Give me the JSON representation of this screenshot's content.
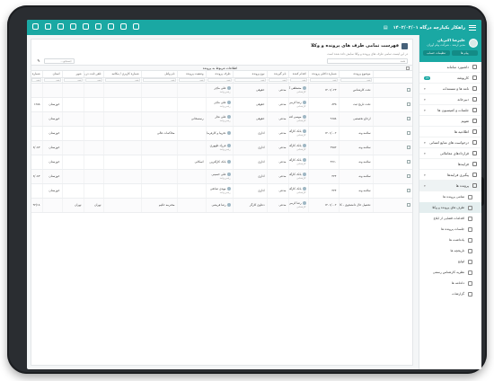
{
  "app": {
    "title": "راهکار یکپارچه درگاه ۱۴۰۲/۰۲/۰۱"
  },
  "profile": {
    "name": "علیرضا اکبریان",
    "role": "مدیر ارشد - شرکت پیام آوران",
    "btn_inbox": "پیام ها",
    "btn_settings": "تنظیمات حساب"
  },
  "sidebar": {
    "items": [
      {
        "label": "داشبورد سامانه",
        "icon": "dashboard-icon",
        "chevron": false
      },
      {
        "label": "کارپوشه",
        "icon": "inbox-icon",
        "badge": "۲۳"
      },
      {
        "label": "نامه ها و مستندات",
        "icon": "mail-icon",
        "chevron": true
      },
      {
        "label": "دبیرخانه",
        "icon": "archive-icon",
        "chevron": true
      },
      {
        "label": "جلسات و کمیسیون ها",
        "icon": "meeting-icon",
        "chevron": true
      },
      {
        "label": "تقویم",
        "icon": "calendar-icon",
        "chevron": false
      },
      {
        "label": "اطلاعیه ها",
        "icon": "bell-icon",
        "chevron": false
      },
      {
        "label": "درخواست های منابع انسانی",
        "icon": "users-icon",
        "chevron": true
      },
      {
        "label": "قراردادهای معاملاتی",
        "icon": "contract-icon",
        "chevron": true
      },
      {
        "label": "فرایندها",
        "icon": "flow-icon",
        "chevron": false
      },
      {
        "label": "پیگیری فرایندها",
        "icon": "track-icon",
        "chevron": true
      },
      {
        "label": "پرونده ها",
        "icon": "folder-icon",
        "chevron": true,
        "active": true
      }
    ],
    "subitems": [
      {
        "label": "تمامی پرونده ها",
        "icon": "folders-icon"
      },
      {
        "label": "طرف های پرونده و وکلا",
        "icon": "parties-icon",
        "current": true
      },
      {
        "label": "اقدامات قضایی از ابلاغ",
        "icon": "gavel-icon"
      },
      {
        "label": "جلسات پرونده ها",
        "icon": "session-icon"
      },
      {
        "label": "یادداشت ها",
        "icon": "note-icon"
      },
      {
        "label": "تاریخچه ها",
        "icon": "history-icon"
      },
      {
        "label": "لوایح",
        "icon": "doc-icon"
      },
      {
        "label": "نظریه کارشناس رسمی",
        "icon": "expert-icon"
      },
      {
        "label": "دادنامه ها",
        "icon": "verdict-icon"
      },
      {
        "label": "گزارشات",
        "icon": "report-icon"
      }
    ]
  },
  "main": {
    "title": "فهرست تمامی طرف های پرونده و وکلا",
    "subtitle": "در این لیست تمامی طرف های پرونده و وکلا نمایش داده شده است",
    "select_placeholder": "همه",
    "search_placeholder": "جستجو...",
    "group_title": "اطلاعات مربوط به پرونده",
    "columns": [
      "موضوع پرونده",
      "شماره داخلی پرونده",
      "اقدام کننده",
      "نام گیرنده",
      "نوع پرونده",
      "طرف پرونده",
      "وضعیت پرونده",
      "نام وکیل",
      "شماره کاربری / مکاتبه",
      "تلفن ثابت در پرونده",
      "شهر",
      "استان",
      "شماره"
    ],
    "filter_text": "همه",
    "rows": [
      {
        "subject": "تحت کارشناس",
        "internal": "۱۴۰۱/۰۲۳",
        "actor": "مصطفی آرا",
        "actor_sub": "کارشناس",
        "type": "مدعی",
        "kind": "حقوقی",
        "party": "علی ماچر",
        "party_sub": "رئیس واحد",
        "status": "",
        "lawyer": "",
        "phone": "",
        "city": "",
        "province": "",
        "no": ""
      },
      {
        "subject": "تحت تاریخ ثبت",
        "internal": "۸۳۵",
        "actor": "رضا کرمی",
        "actor_sub": "کارشناس",
        "type": "مدعی",
        "kind": "حقوقی",
        "party": "علی ماچر",
        "party_sub": "رئیس واحد",
        "status": "",
        "lawyer": "",
        "phone": "",
        "city": "",
        "province": "خوزستان",
        "no": "۱۶۸۵"
      },
      {
        "subject": "ارجاع تخصصی",
        "internal": "۹۶۵۸",
        "actor": "موسی افتخار",
        "actor_sub": "کارشناس",
        "type": "مدعی",
        "kind": "حقوقی",
        "party": "علی نجار",
        "party_sub": "رئیس واحد",
        "status": "رستمخانی",
        "lawyer": "",
        "phone": "",
        "city": "",
        "province": "خوزستان",
        "no": ""
      },
      {
        "subject": "سلامه ونه",
        "internal": "۱۴۰۱/۰۰۲",
        "actor": "بانک کارآفرین",
        "actor_sub": "کارشناس",
        "type": "مدعی",
        "kind": "اداری",
        "party": "تخریبا و کارفرمایی",
        "party_sub": "",
        "status": "",
        "lawyer": "محاکمات عالی",
        "phone": "",
        "city": "",
        "province": "خوزستان",
        "no": ""
      },
      {
        "subject": "سلامه ونه",
        "internal": "۲۷۵۲",
        "actor": "بانک کارآفرین",
        "actor_sub": "کارشناس",
        "type": "مدعی",
        "kind": "اداری",
        "party": "فرزاد ظهوری",
        "party_sub": "رئیس واحد",
        "status": "",
        "lawyer": "",
        "phone": "",
        "city": "",
        "province": "خوزستان",
        "no": "۶/۰۸۳"
      },
      {
        "subject": "سلامه ونه",
        "internal": "۳۶۶۰",
        "actor": "بانک کارآفرین",
        "actor_sub": "کارشناس",
        "type": "مدعی",
        "kind": "اداری",
        "party": "بانک کارآفرین",
        "party_sub": "",
        "status": "اسکانی",
        "lawyer": "",
        "phone": "",
        "city": "",
        "province": "خوزستان",
        "no": ""
      },
      {
        "subject": "سلامه ونه",
        "internal": "۴۴۴",
        "actor": "بانک کارآفرین",
        "actor_sub": "کارشناس",
        "type": "مدعی",
        "kind": "اداری",
        "party": "علی حسینی",
        "party_sub": "رئیس واحد",
        "status": "",
        "lawyer": "",
        "phone": "",
        "city": "",
        "province": "خوزستان",
        "no": "۶/۰۸۳"
      },
      {
        "subject": "سلامه ونه",
        "internal": "۴۴۴",
        "actor": "بانک کارآفرین",
        "actor_sub": "کارشناس",
        "type": "مدعی",
        "kind": "اداری",
        "party": "مهدی صادقی",
        "party_sub": "رئیس واحد",
        "status": "",
        "lawyer": "",
        "phone": "",
        "city": "",
        "province": "خوزستان",
        "no": ""
      },
      {
        "subject": "تحصیل حال دانشجوی - کارشناسی ارشد",
        "internal": "۱۴۰۱/۰۰۲",
        "actor": "رضا کرمی",
        "actor_sub": "کارشناس",
        "type": "مدعی",
        "kind": "دعاوی کارگر",
        "party": "رضا قریشی",
        "party_sub": "",
        "status": "",
        "lawyer": "محترمه حکیم",
        "phone": "تهران",
        "city": "تهران",
        "province": "",
        "no": "۹۲/۱۸"
      }
    ]
  }
}
